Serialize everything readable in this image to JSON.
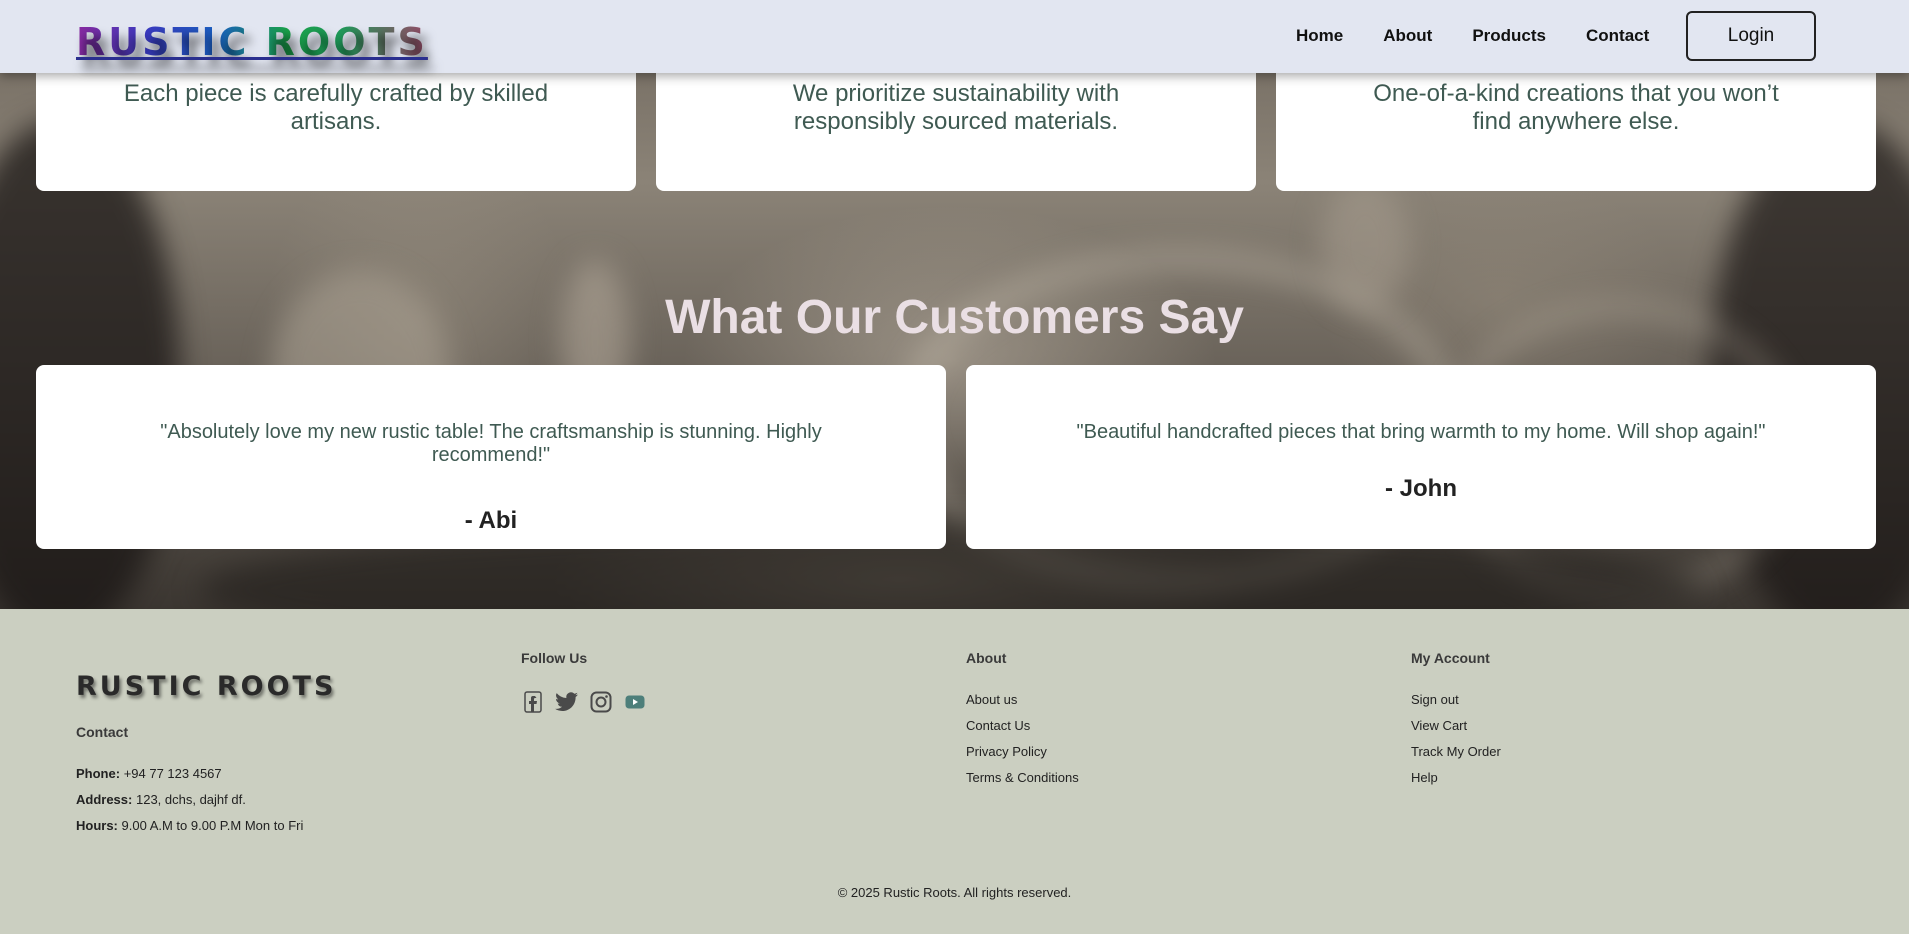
{
  "header": {
    "logo": "RUSTIC ROOTS",
    "nav": [
      "Home",
      "About",
      "Products",
      "Contact"
    ],
    "login_label": "Login"
  },
  "features": [
    "Each piece is carefully crafted by skilled artisans.",
    "We prioritize sustainability with responsibly sourced materials.",
    "One-of-a-kind creations that you won’t find anywhere else."
  ],
  "testimonials": {
    "title": "What Our Customers Say",
    "items": [
      {
        "quote": "\"Absolutely love my new rustic table! The craftsmanship is stunning. Highly recommend!\"",
        "author": "- Abi"
      },
      {
        "quote": "\"Beautiful handcrafted pieces that bring warmth to my home. Will shop again!\"",
        "author": "- John"
      }
    ]
  },
  "footer": {
    "logo": "RUSTIC ROOTS",
    "contact_heading": "Contact",
    "phone_label": "Phone:",
    "phone": "+94 77 123 4567",
    "address_label": "Address:",
    "address": "123, dchs, dajhf df.",
    "hours_label": "Hours:",
    "hours": "9.00 A.M to 9.00 P.M Mon to Fri",
    "follow_heading": "Follow Us",
    "social_icons": [
      "facebook-icon",
      "twitter-icon",
      "instagram-icon",
      "youtube-icon"
    ],
    "about_heading": "About",
    "about_links": [
      "About us",
      "Contact Us",
      "Privacy Policy",
      "Terms & Conditions"
    ],
    "account_heading": "My Account",
    "account_links": [
      "Sign out",
      "View Cart",
      "Track My Order",
      "Help"
    ],
    "copyright": "© 2025 Rustic Roots. All rights reserved."
  },
  "colors": {
    "header_bg": "#e2e6f1",
    "footer_bg": "#cbcfc1",
    "card_text": "#3f5a52",
    "section_title": "#eadfe4"
  }
}
